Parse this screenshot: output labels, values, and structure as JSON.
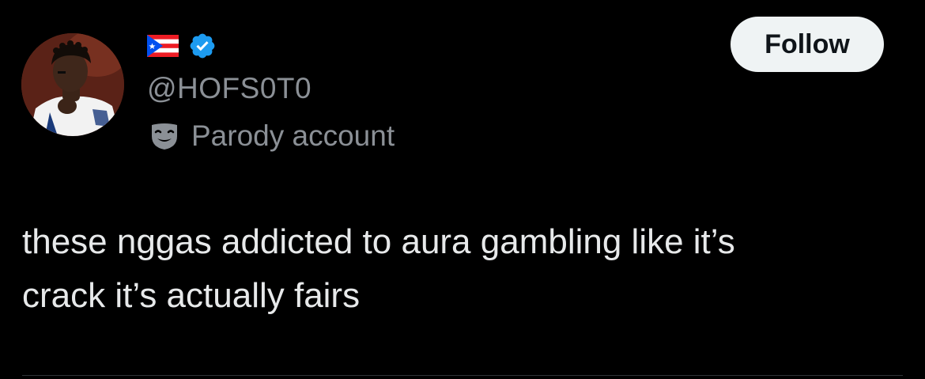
{
  "colors": {
    "background": "#000000",
    "text_primary": "#e7e9ea",
    "text_secondary": "#8b9096",
    "verified_blue": "#1d9bf0",
    "follow_button_bg": "#eff3f4",
    "follow_button_text": "#0f1419"
  },
  "author": {
    "avatar_icon": "profile-photo",
    "flag_icon": "puerto-rico-flag",
    "verified_icon": "verified-badge",
    "handle": "@HOFS0T0",
    "label_icon": "parody-mask",
    "label": "Parody account"
  },
  "actions": {
    "follow_label": "Follow"
  },
  "tweet": {
    "text": "these nggas addicted to aura gambling like it’s\ncrack it’s actually fairs"
  }
}
